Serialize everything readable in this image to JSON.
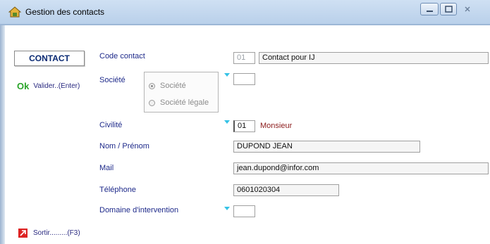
{
  "window": {
    "title": "Gestion des contacts",
    "controls": {
      "minimize": "minimize-icon",
      "maximize": "maximize-icon",
      "close": "close-icon"
    }
  },
  "sidebar": {
    "header": "CONTACT",
    "validate_ok": "Ok",
    "validate_label": "Valider..(Enter)",
    "exit_label": "Sortir.........(F3)"
  },
  "form": {
    "code_contact": {
      "label": "Code contact",
      "code": "01",
      "value": "Contact pour IJ"
    },
    "societe": {
      "label": "Société",
      "options": [
        "Société",
        "Société légale"
      ],
      "selected": "Société",
      "code": ""
    },
    "civilite": {
      "label": "Civilité",
      "code": "01",
      "value": "Monsieur"
    },
    "nom_prenom": {
      "label": "Nom / Prénom",
      "value": "DUPOND JEAN"
    },
    "mail": {
      "label": "Mail",
      "value": "jean.dupond@infor.com"
    },
    "telephone": {
      "label": "Téléphone",
      "value": "0601020304"
    },
    "domaine": {
      "label": "Domaine d'intervention",
      "code": ""
    }
  },
  "colors": {
    "label": "#1e2a8a",
    "civilite_value": "#8b1a1a",
    "dropdown_arrow": "#35c2e6",
    "ok": "#2aa52a",
    "exit_icon": "#dd2222"
  }
}
